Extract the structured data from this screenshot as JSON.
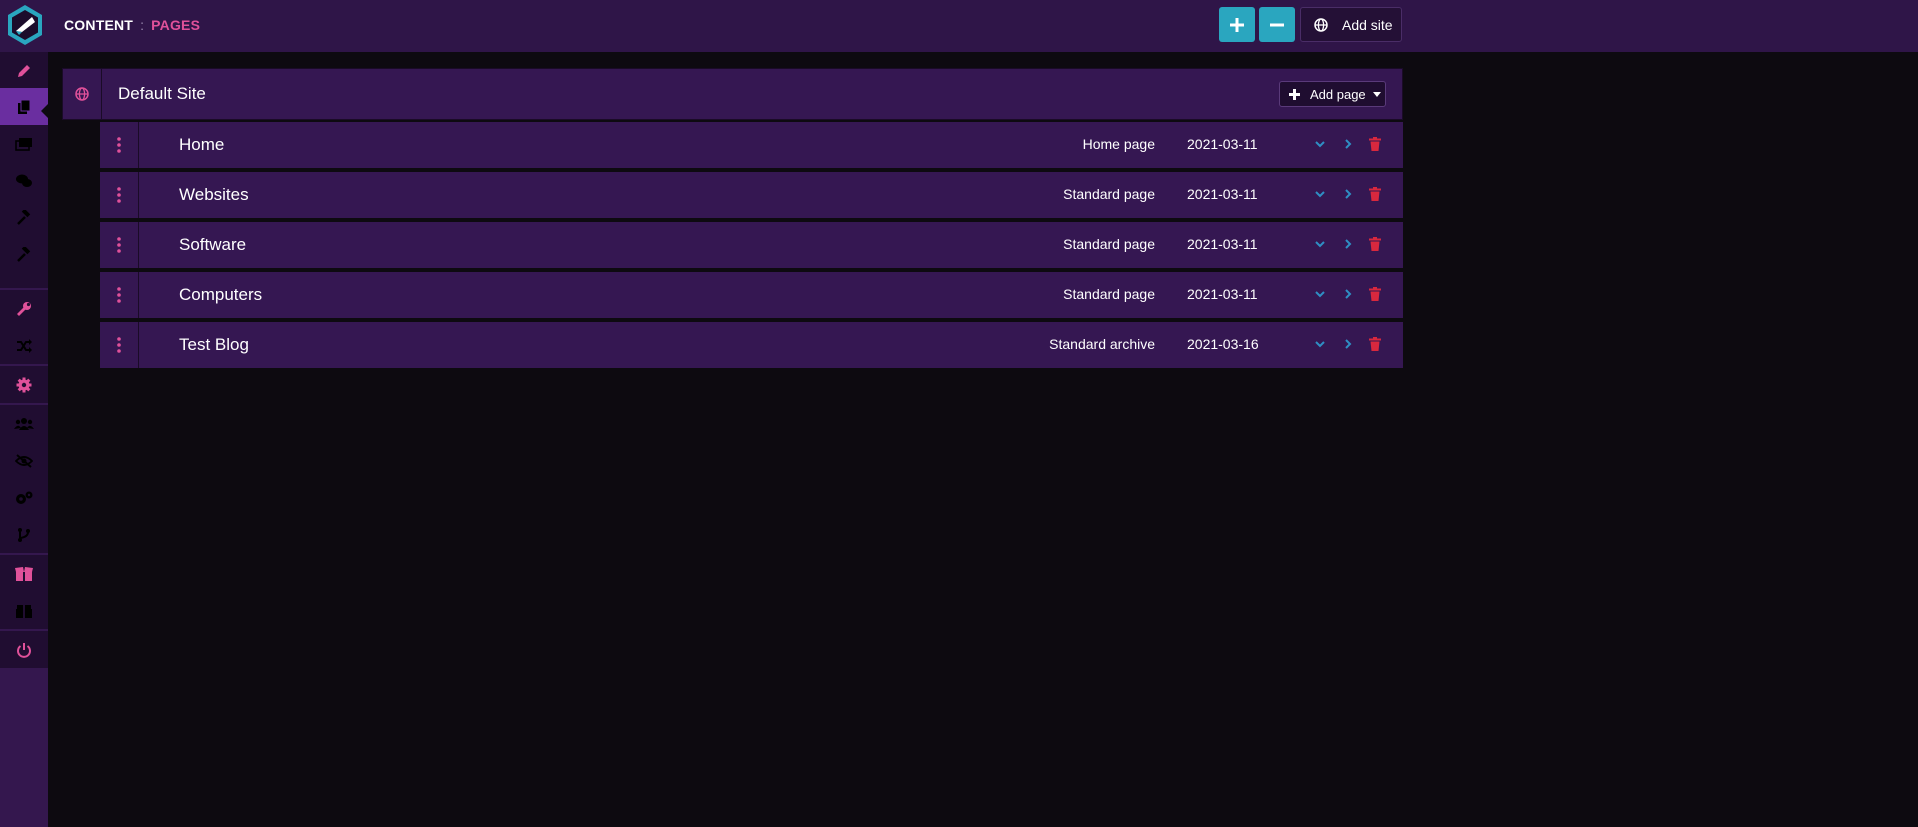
{
  "header": {
    "section": "CONTENT",
    "separator": ":",
    "page": "PAGES",
    "expand_all_icon": "plus-icon",
    "collapse_all_icon": "minus-icon",
    "add_site_label": "Add site"
  },
  "sidebar": {
    "items": [
      {
        "icon": "pencil-icon"
      },
      {
        "icon": "pages-icon",
        "active": true
      },
      {
        "icon": "media-icon"
      },
      {
        "icon": "comments-icon"
      },
      {
        "icon": "hammer-icon"
      },
      {
        "icon": "hammer-icon"
      },
      {
        "icon": "wrench-icon"
      },
      {
        "icon": "shuffle-icon"
      },
      {
        "icon": "gear-icon"
      },
      {
        "icon": "users-icon"
      },
      {
        "icon": "eye-slash-icon"
      },
      {
        "icon": "cogs-icon"
      },
      {
        "icon": "branch-icon"
      },
      {
        "icon": "package-open-icon"
      },
      {
        "icon": "package-icon"
      },
      {
        "icon": "power-icon"
      }
    ]
  },
  "site": {
    "name": "Default Site",
    "add_page_label": "Add page"
  },
  "pages": [
    {
      "title": "Home",
      "type": "Home page",
      "date": "2021-03-11"
    },
    {
      "title": "Websites",
      "type": "Standard page",
      "date": "2021-03-11"
    },
    {
      "title": "Software",
      "type": "Standard page",
      "date": "2021-03-11"
    },
    {
      "title": "Computers",
      "type": "Standard page",
      "date": "2021-03-11"
    },
    {
      "title": "Test Blog",
      "type": "Standard archive",
      "date": "2021-03-16"
    }
  ],
  "colors": {
    "accent_pink": "#e0519a",
    "accent_teal": "#2aa6bf",
    "action_blue": "#2f8fc4",
    "delete_red": "#d9283e",
    "panel_purple": "#351752"
  }
}
